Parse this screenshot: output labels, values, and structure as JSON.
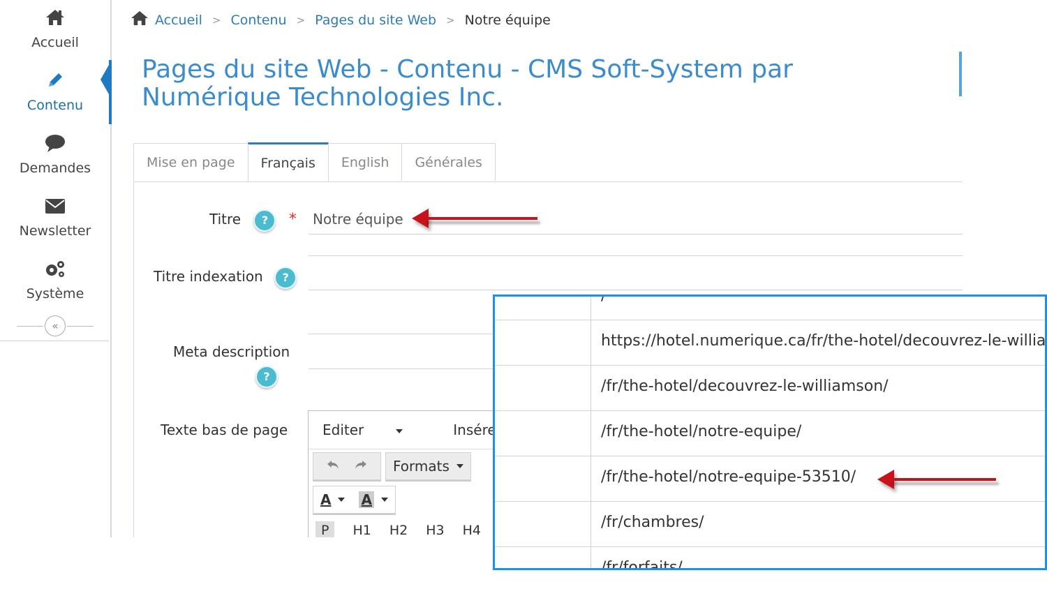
{
  "sidebar": {
    "items": [
      {
        "label": "Accueil",
        "icon": "home-icon"
      },
      {
        "label": "Contenu",
        "icon": "pencil-icon",
        "active": true
      },
      {
        "label": "Demandes",
        "icon": "speech-bubble-icon"
      },
      {
        "label": "Newsletter",
        "icon": "envelope-icon"
      },
      {
        "label": "Système",
        "icon": "gears-icon"
      }
    ],
    "collapse_symbol": "«"
  },
  "breadcrumb": {
    "items": [
      "Accueil",
      "Contenu",
      "Pages du site Web"
    ],
    "current": "Notre équipe",
    "separator": ">"
  },
  "page_title": "Pages du site Web - Contenu - CMS Soft-System par Numérique Technologies Inc.",
  "tabs": [
    {
      "label": "Mise en page"
    },
    {
      "label": "Français",
      "active": true
    },
    {
      "label": "English"
    },
    {
      "label": "Générales"
    }
  ],
  "form": {
    "titre_label": "Titre",
    "titre_value": "Notre équipe",
    "required_mark": "*",
    "titre_indexation_label": "Titre indexation",
    "meta_description_label": "Meta description",
    "texte_bas_label": "Texte bas de page",
    "help_symbol": "?"
  },
  "editor": {
    "menu": [
      "Editer",
      "Insérer"
    ],
    "formats_label": "Formats",
    "font_color": "A",
    "bg_color": "A",
    "headings": [
      "P",
      "H1",
      "H2",
      "H3",
      "H4"
    ]
  },
  "overlay": {
    "rows": [
      "/",
      "https://hotel.numerique.ca/fr/the-hotel/decouvrez-le-williamson/",
      "/fr/the-hotel/decouvrez-le-williamson/",
      "/fr/the-hotel/notre-equipe/",
      "/fr/the-hotel/notre-equipe-53510/",
      "/fr/chambres/",
      "/fr/forfaits/"
    ]
  },
  "colors": {
    "accent": "#2d7cb8",
    "title": "#3a8ccf",
    "overlay_border": "#1e90e8",
    "arrow": "#c8121c",
    "help": "#4bbcd0"
  }
}
